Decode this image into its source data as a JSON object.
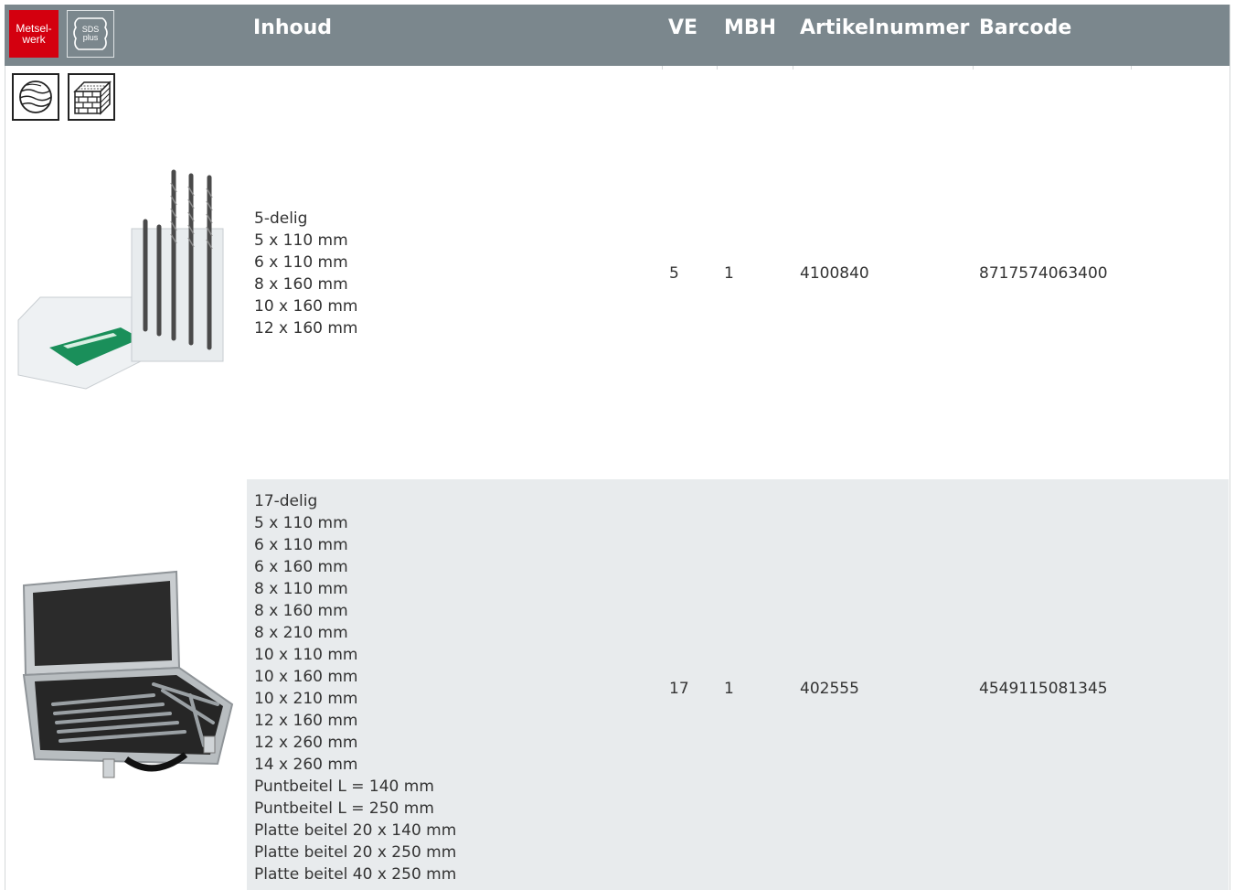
{
  "badges": {
    "category_line1": "Metsel-",
    "category_line2": "werk",
    "sds_line1": "SDS",
    "sds_line2": "plus"
  },
  "header": {
    "content": "Inhoud",
    "ve": "VE",
    "mbh": "MBH",
    "article": "Artikelnummer",
    "barcode": "Barcode"
  },
  "colors": {
    "header_bg": "#7b878d",
    "category_badge": "#d4000f",
    "alt_row_bg": "#e8ebed"
  },
  "rows": [
    {
      "lines": [
        "5-delig",
        "5 x 110 mm",
        "6 x 110 mm",
        "8 x 160 mm",
        "10 x 160 mm",
        "12 x 160 mm"
      ],
      "ve": "5",
      "mbh": "1",
      "article": "4100840",
      "barcode": "8717574063400"
    },
    {
      "lines": [
        "17-delig",
        "5 x 110 mm",
        "6 x 110 mm",
        "6 x 160 mm",
        "8 x 110 mm",
        "8 x 160 mm",
        "8 x 210 mm",
        "10 x 110 mm",
        "10 x 160 mm",
        "10 x 210 mm",
        "12 x 160 mm",
        "12 x 260 mm",
        "14 x 260 mm",
        "Puntbeitel L = 140 mm",
        "Puntbeitel L = 250 mm",
        "Platte beitel 20 x 140 mm",
        "Platte beitel 20 x 250 mm",
        "Platte beitel 40 x 250 mm"
      ],
      "ve": "17",
      "mbh": "1",
      "article": "402555",
      "barcode": "4549115081345"
    }
  ]
}
